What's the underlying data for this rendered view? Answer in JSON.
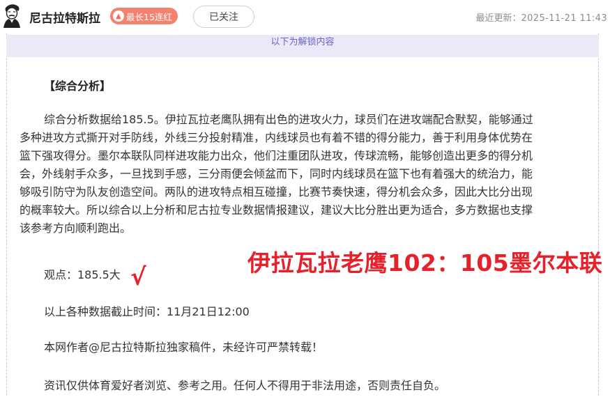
{
  "header": {
    "author_name": "尼古拉特斯拉",
    "streak_badge": "最长15连红",
    "follow_label": "已关注",
    "update_prefix": "最近更新：",
    "update_time": "2025-11-21 11:43"
  },
  "unlock_banner": "以下为解锁内容",
  "content": {
    "section_heading": "【综合分析】",
    "analysis_lines": [
      "综合分析数据给185.5。伊拉瓦拉老鹰队拥有出色的进攻火力，球员们在进攻端配合默契，能够通过",
      "多种进攻方式撕开对手防线，外线三分投射精准，内线球员也有着不错的得分能力，善于利用身体优势在",
      "篮下强攻得分。墨尔本联队同样进攻能力出众，他们注重团队进攻，传球流畅，能够创造出更多的得分机",
      "会，外线射手众多，一旦找到手感，三分雨便会倾盆而下，同时内线球员在篮下也有着强大的统治力，能",
      "够吸引防守为队友创造空间。两队的进攻特点相互碰撞，比赛节奏快速，得分机会众多，因此大比分出现",
      "的概率较大。所以综合以上分析和尼古拉专业数据情报建议，建议大比分胜出更为适合，多方数据也支撑",
      "该参考方向顺利跑出。"
    ],
    "viewpoint": "观点：185.5大",
    "check_mark": "√",
    "score_overlay": "伊拉瓦拉老鹰102：105墨尔本联",
    "cutoff_time": "以上各种数据截止时间：11月21日12:00",
    "copyright": "本网作者@尼古拉特斯拉独家稿件，未经许可严禁转载！",
    "disclaimer": "资讯仅供体育爱好者浏览、参考之用。任何人不得用于非法用途，否则责任自负。"
  },
  "colors": {
    "accent_red": "#e8202a",
    "badge_orange": "#f4826e",
    "banner_bg": "#ebe9f8",
    "banner_text": "#6b63c6"
  },
  "icons": {
    "avatar": "tesla-portrait-avatar",
    "badge": "fire-icon"
  }
}
